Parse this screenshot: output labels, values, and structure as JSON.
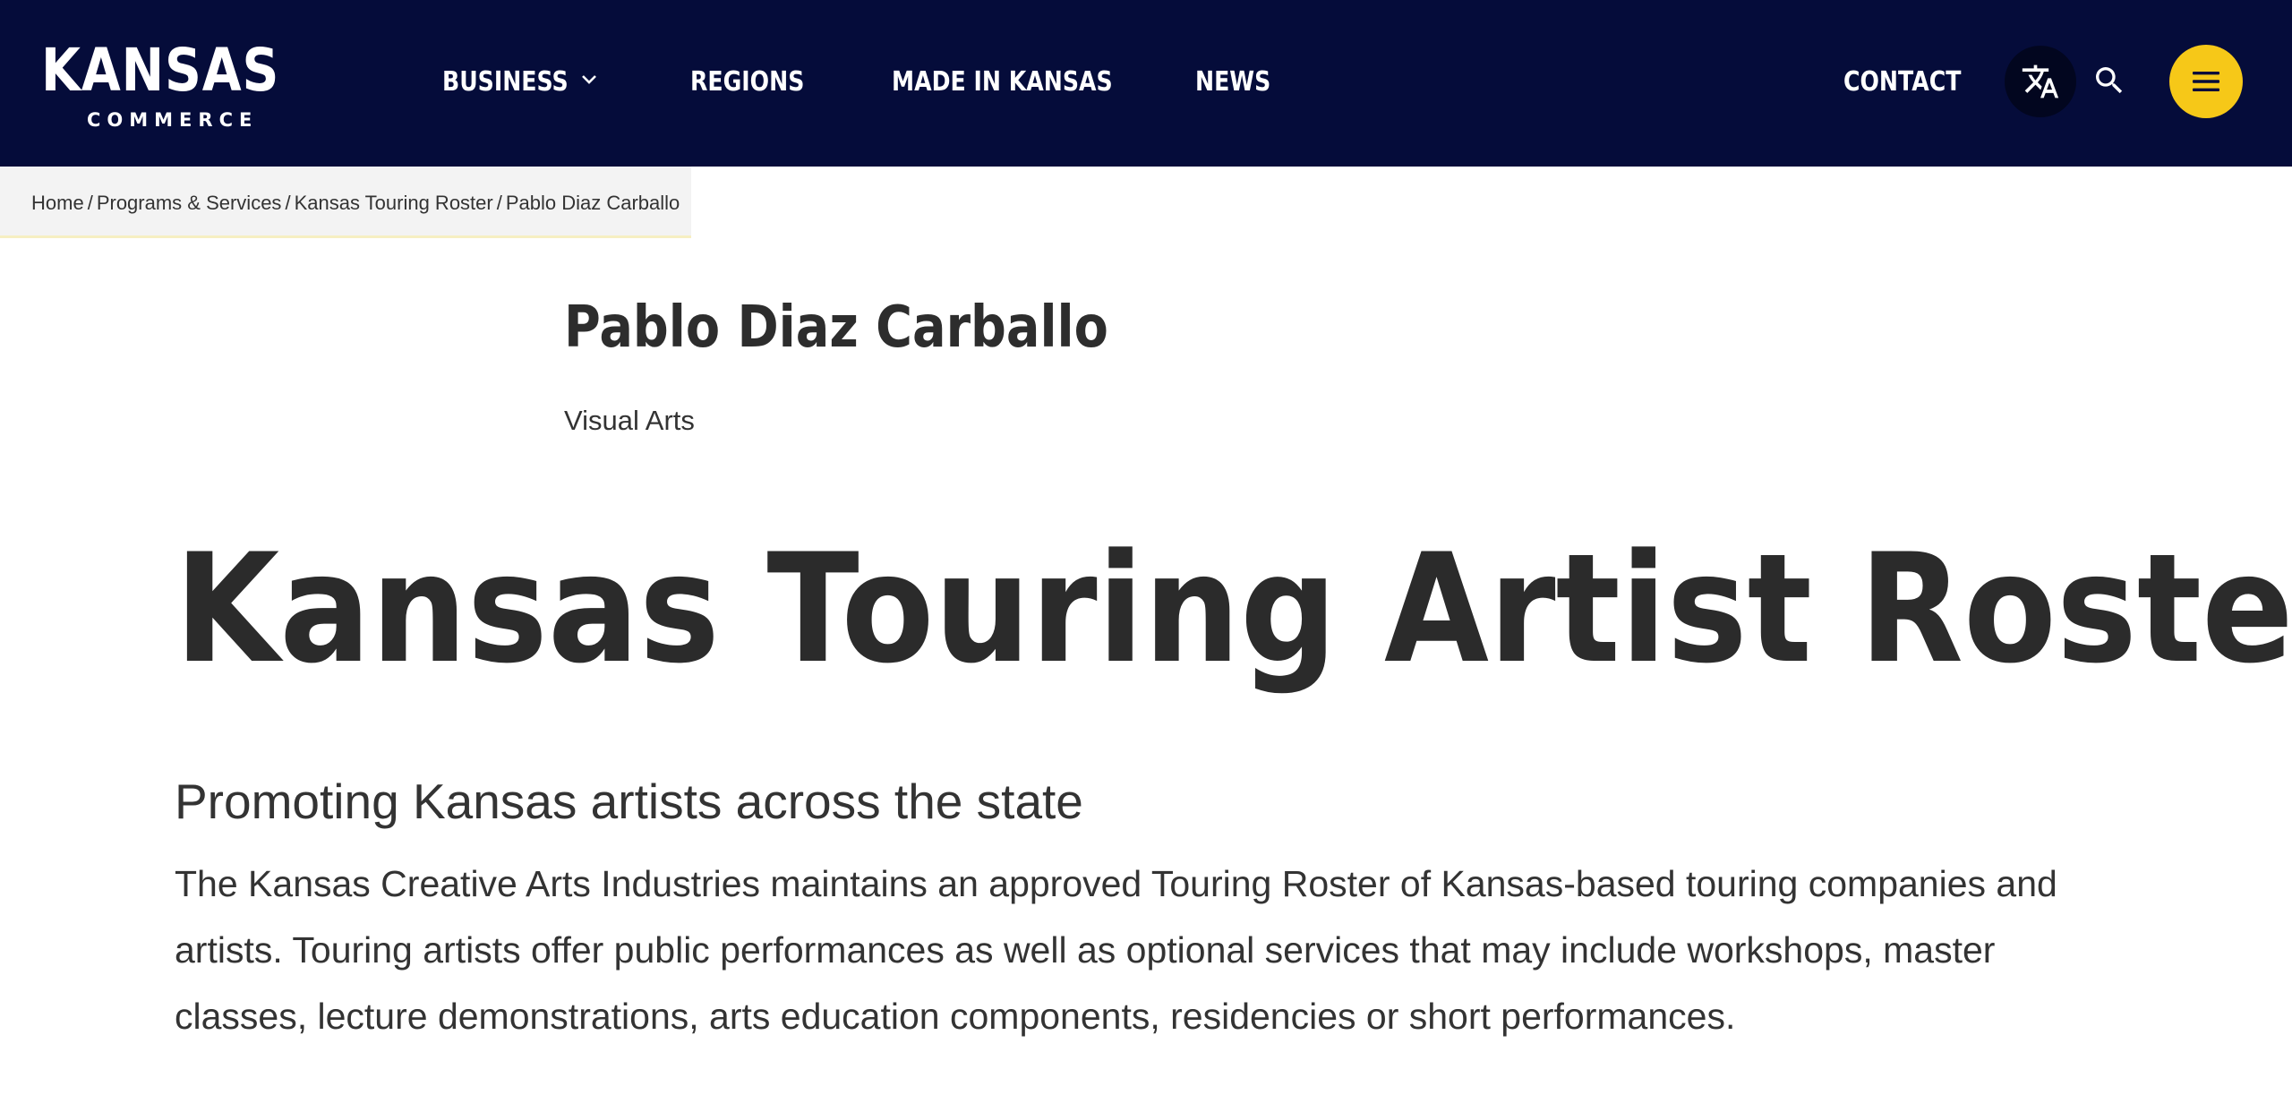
{
  "header": {
    "logo": {
      "main": "KANSAS",
      "sub": "COMMERCE"
    },
    "nav": {
      "business": "BUSINESS",
      "regions": "REGIONS",
      "made_in_kansas": "MADE IN KANSAS",
      "news": "NEWS",
      "contact": "CONTACT"
    },
    "icons": {
      "translate": "translate-icon",
      "search": "search-icon",
      "menu": "hamburger-menu-icon",
      "dropdown": "chevron-down-icon"
    }
  },
  "breadcrumb": {
    "items": [
      "Home",
      "Programs & Services",
      "Kansas Touring Roster",
      "Pablo Diaz Carballo"
    ],
    "separator": "/"
  },
  "page": {
    "title": "Pablo Diaz Carballo",
    "subtitle": "Visual Arts"
  },
  "roster": {
    "heading": "Kansas Touring Artist Roster",
    "tagline": "Promoting Kansas artists across the state",
    "body_lines": [
      "The Kansas Creative Arts Industries maintains an approved Touring Roster of Kansas-based touring companies and",
      "artists. Touring artists offer public performances as well as optional services that may include workshops, master",
      "classes, lecture demonstrations, arts education components, residencies or short performances."
    ]
  },
  "colors": {
    "header_bg": "#050c3a",
    "accent_yellow": "#f6c818",
    "translate_bg": "#02061f",
    "text": "#333333"
  }
}
